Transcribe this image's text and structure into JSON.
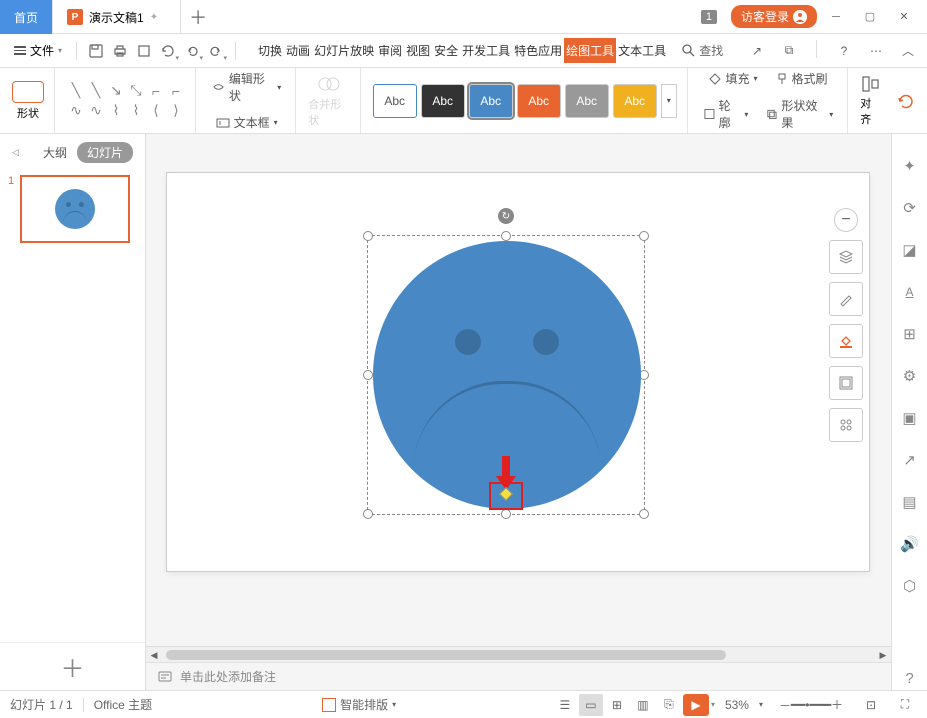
{
  "titlebar": {
    "home_tab": "首页",
    "doc_tab": "演示文稿1",
    "page_badge": "1",
    "login": "访客登录"
  },
  "menubar": {
    "file": "文件",
    "tabs": [
      "切换",
      "动画",
      "幻灯片放映",
      "审阅",
      "视图",
      "安全",
      "开发工具",
      "特色应用",
      "绘图工具",
      "文本工具"
    ],
    "active_tab_index": 8,
    "search": "查找"
  },
  "ribbon": {
    "shape_label": "形状",
    "edit_shape": "编辑形状",
    "text_box": "文本框",
    "merge_shape": "合并形状",
    "swatch_label": "Abc",
    "fill": "填充",
    "format_brush": "格式刷",
    "outline": "轮廓",
    "shape_effects": "形状效果",
    "align": "对齐"
  },
  "slidepanel": {
    "outline": "大纲",
    "slides": "幻灯片",
    "slide_num": "1"
  },
  "floatbar": {
    "items": [
      "minus",
      "layers",
      "pen",
      "bucket",
      "frame",
      "component"
    ]
  },
  "notes": {
    "placeholder": "单击此处添加备注"
  },
  "statusbar": {
    "slide_info": "幻灯片 1 / 1",
    "theme": "Office 主题",
    "smart_layout": "智能排版",
    "zoom": "53%"
  },
  "chart_data": {
    "type": "diagram",
    "description": "Sad face shape selected on slide with yellow adjustment diamond highlighted by red square marker and red arrow",
    "face_color": "#4889c5",
    "eye_color": "#3a6fa0"
  }
}
